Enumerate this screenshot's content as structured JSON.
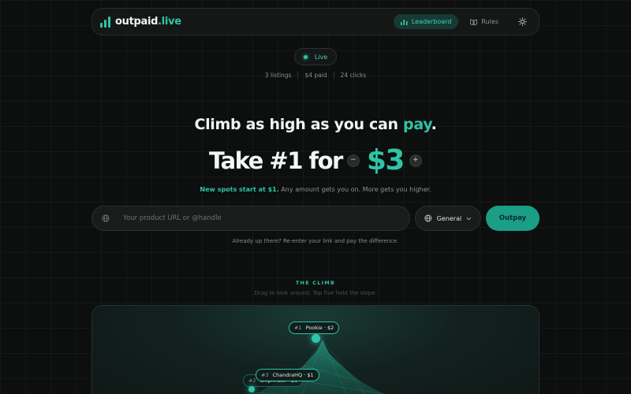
{
  "nav": {
    "logo_text": "outpaid",
    "logo_tld": ".live",
    "leaderboard_label": "Leaderboard",
    "rules_label": "Rules"
  },
  "status": {
    "live_label": "Live"
  },
  "stats": {
    "listings": "3 listings",
    "paid": "$4 paid",
    "clicks": "24 clicks"
  },
  "hero": {
    "headline_text": "Climb as high as you can",
    "headline_accent": "pay",
    "headline_end": ".",
    "take_label": "Take #1 for",
    "price": "$3",
    "minus": "−",
    "plus": "+",
    "sub_highlight": "New spots start at $1.",
    "sub_text": " Any amount gets you on. More gets you higher."
  },
  "form": {
    "url_placeholder": "Your product URL or @handle",
    "category_selected": "General",
    "submit_label": "Outpay",
    "note": "Already up there? Re-enter your link and pay the difference."
  },
  "climb": {
    "label": "THE CLIMB",
    "subtitle": "Drag to look around. Top five hold the slope.",
    "entries": [
      {
        "rank": "#1",
        "name": "Pookie · $2"
      },
      {
        "rank": "#3",
        "name": "ChandraHQ · $1"
      },
      {
        "rank": "#2",
        "name": "Shipfinder · $1"
      }
    ]
  },
  "colors": {
    "accent": "#2ec4a6",
    "background": "#0d0e0e",
    "button": "#1a9e86"
  }
}
